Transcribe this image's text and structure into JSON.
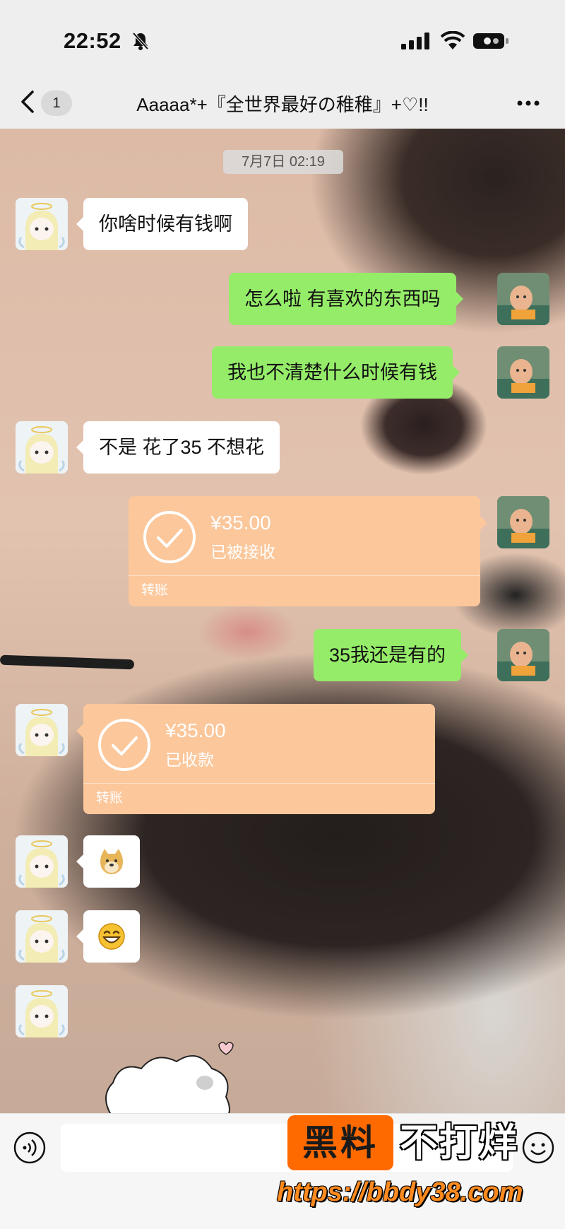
{
  "status_bar": {
    "time": "22:52",
    "icons": [
      "bell-off-icon",
      "signal-icon",
      "wifi-icon",
      "battery-icon"
    ]
  },
  "nav": {
    "back_icon": "chevron-left-icon",
    "unread_count": "1",
    "title": "Aaaaa*+『全世界最好の稚稚』+♡!!",
    "more_icon": "more-dots-icon"
  },
  "chat": {
    "timestamp": "7月7日 02:19",
    "messages": [
      {
        "side": "left",
        "type": "text",
        "text": "你啥时候有钱啊"
      },
      {
        "side": "right",
        "type": "text",
        "text": "怎么啦 有喜欢的东西吗"
      },
      {
        "side": "right",
        "type": "text",
        "text": "我也不清楚什么时候有钱"
      },
      {
        "side": "left",
        "type": "text",
        "text": "不是 花了35 不想花"
      },
      {
        "side": "right",
        "type": "transfer",
        "amount": "¥35.00",
        "status": "已被接收",
        "label": "转账"
      },
      {
        "side": "right",
        "type": "text",
        "text": "35我还是有的"
      },
      {
        "side": "left",
        "type": "transfer",
        "amount": "¥35.00",
        "status": "已收款",
        "label": "转账"
      },
      {
        "side": "left",
        "type": "sticker",
        "icon": "doge-emoji-icon"
      },
      {
        "side": "left",
        "type": "sticker",
        "icon": "grin-emoji-icon"
      },
      {
        "side": "left",
        "type": "avatar-only"
      }
    ]
  },
  "input_bar": {
    "voice_icon": "voice-icon",
    "input_value": "",
    "emoji_icon": "emoji-icon"
  },
  "watermark": {
    "box_text": "黑料",
    "text": "不打烊",
    "url": "https://bbdy38.com"
  },
  "colors": {
    "bubble_right": "#95ec69",
    "bubble_left": "#ffffff",
    "transfer": "#fbc79b",
    "watermark_orange": "#ff6a00"
  }
}
